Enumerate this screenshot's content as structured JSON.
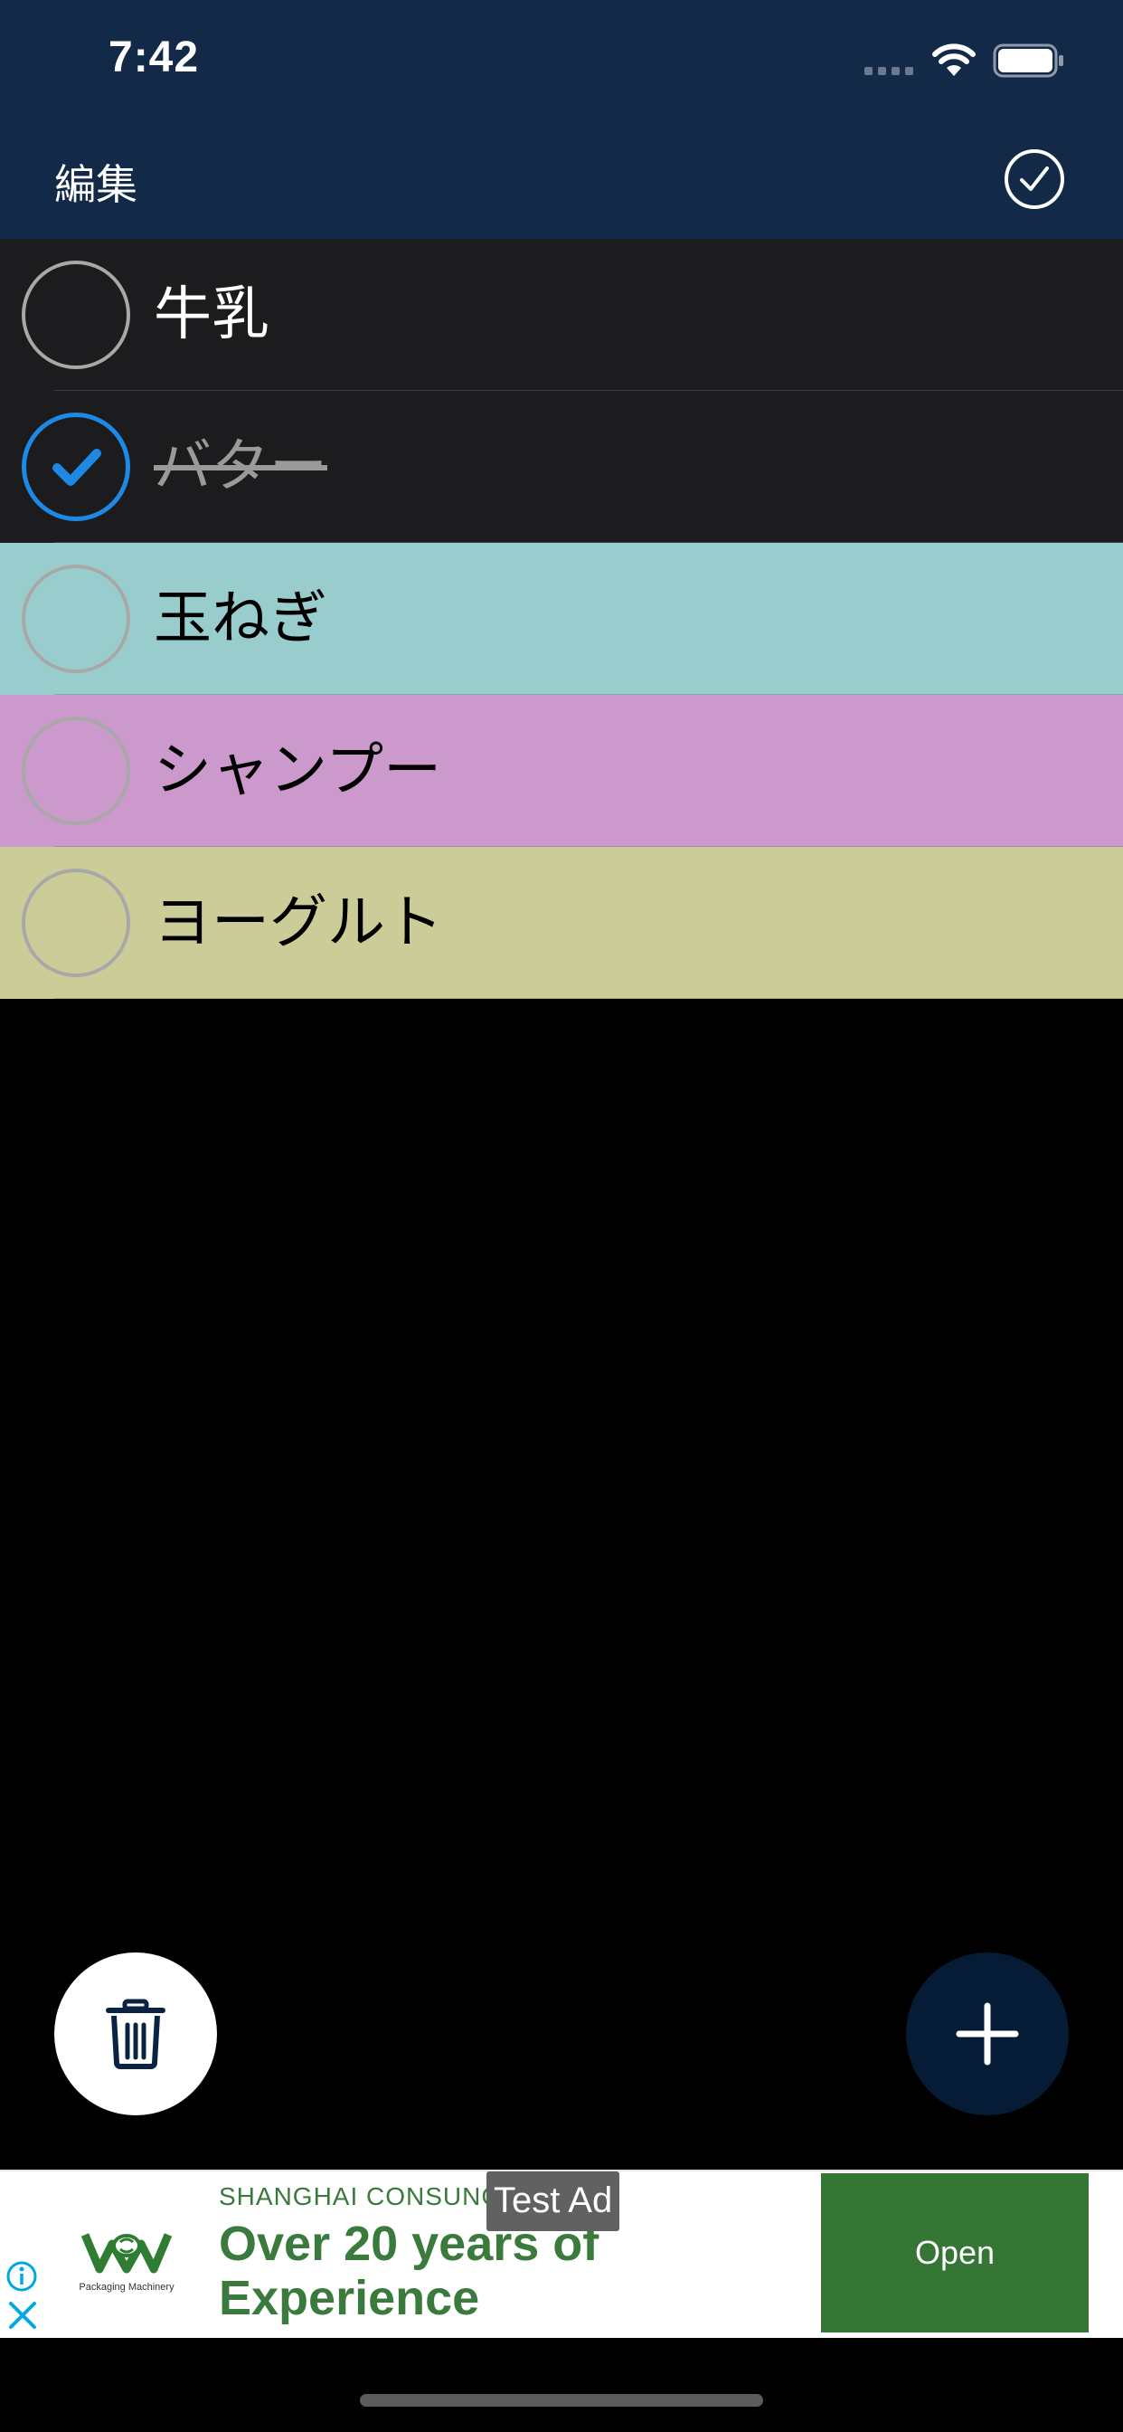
{
  "status_bar": {
    "time": "7:42",
    "wifi_icon": "wifi-icon",
    "battery_icon": "battery-icon"
  },
  "nav_bar": {
    "edit_label": "編集",
    "done_icon": "checkmark-circle-icon",
    "background_color": "#122947"
  },
  "list": {
    "items": [
      {
        "label": "牛乳",
        "checked": false,
        "background_color": "#1c1c1e",
        "text_color": "#ffffff"
      },
      {
        "label": "バター",
        "checked": true,
        "background_color": "#1c1c1e",
        "text_color": "#9a9a9a"
      },
      {
        "label": "玉ねぎ",
        "checked": false,
        "background_color": "#99cccc",
        "text_color": "#000000"
      },
      {
        "label": "シャンプー",
        "checked": false,
        "background_color": "#cc99cc",
        "text_color": "#000000"
      },
      {
        "label": "ヨーグルト",
        "checked": false,
        "background_color": "#cccc99",
        "text_color": "#000000"
      }
    ],
    "checked_color": "#1e88e5"
  },
  "fabs": {
    "delete_icon": "trash-icon",
    "add_icon": "plus-icon"
  },
  "ad": {
    "test_label": "Test Ad",
    "advertiser": "SHANGHAI CONSUNG",
    "headline": "Over 20 years of Experience",
    "logo_caption": "Packaging Machinery",
    "open_label": "Open",
    "accent_color": "#357634"
  }
}
